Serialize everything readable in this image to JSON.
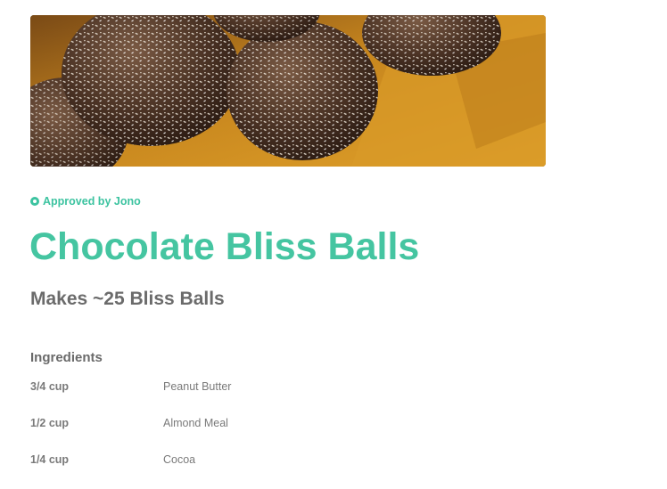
{
  "hero_image": {
    "alt": "Coconut-coated chocolate bliss balls on a wooden board"
  },
  "approval": {
    "text": "Approved by Jono",
    "icon": "check-circle-icon",
    "color": "#3cc3a0"
  },
  "recipe": {
    "title": "Chocolate Bliss Balls",
    "yield": "Makes ~25 Bliss Balls",
    "title_color": "#45c5a1"
  },
  "ingredients": {
    "heading": "Ingredients",
    "items": [
      {
        "quantity": "3/4 cup",
        "name": "Peanut Butter"
      },
      {
        "quantity": "1/2 cup",
        "name": "Almond Meal"
      },
      {
        "quantity": "1/4 cup",
        "name": "Cocoa"
      }
    ]
  }
}
